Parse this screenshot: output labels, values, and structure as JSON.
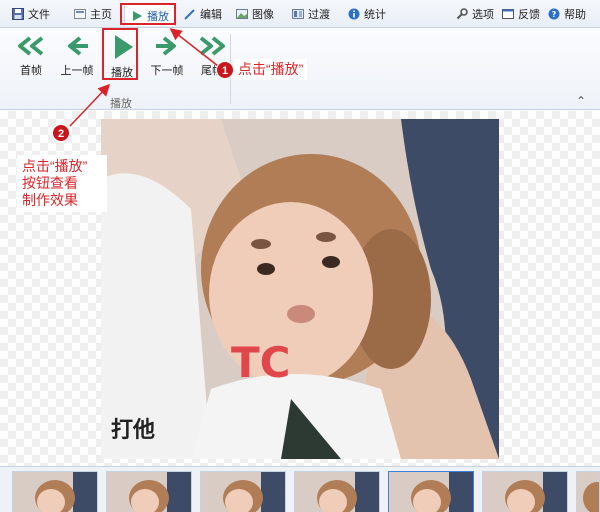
{
  "menu": {
    "items": [
      {
        "label": "文件",
        "icon": "save-icon"
      },
      {
        "label": "主页",
        "icon": "home-icon"
      },
      {
        "label": "播放",
        "icon": "play-small-icon"
      },
      {
        "label": "编辑",
        "icon": "pencil-icon"
      },
      {
        "label": "图像",
        "icon": "image-icon"
      },
      {
        "label": "过渡",
        "icon": "transition-icon"
      },
      {
        "label": "统计",
        "icon": "info-icon"
      }
    ],
    "right": [
      {
        "label": "选项",
        "icon": "wrench-icon"
      },
      {
        "label": "反馈",
        "icon": "feedback-icon"
      },
      {
        "label": "帮助",
        "icon": "help-icon"
      }
    ]
  },
  "ribbon": {
    "buttons": [
      {
        "label": "首帧",
        "icon": "first-frame-icon"
      },
      {
        "label": "上一帧",
        "icon": "previous-frame-icon"
      },
      {
        "label": "播放",
        "icon": "play-icon"
      },
      {
        "label": "下一帧",
        "icon": "next-frame-icon"
      },
      {
        "label": "尾帧",
        "icon": "last-frame-icon"
      }
    ],
    "group_label": "播放"
  },
  "annotations": {
    "callout1": "点击“播放”",
    "callout2_lines": [
      "点击“播放”",
      "按钮查看",
      "制作效果"
    ],
    "badge1": "1",
    "badge2": "2",
    "color": "#d9252a"
  },
  "preview": {
    "caption": "打他"
  },
  "filmstrip": {
    "frame_count": 7,
    "selected_index": 4
  },
  "colors": {
    "accent_green": "#3a9a6b",
    "selection_blue": "#3d7fd6"
  }
}
